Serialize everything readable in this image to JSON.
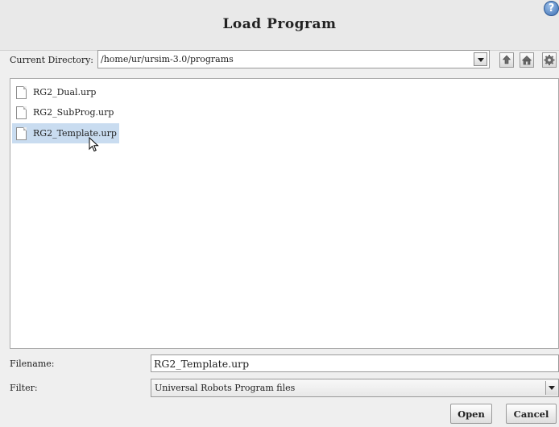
{
  "dialog": {
    "title": "Load Program",
    "help_icon": "help-circle-icon",
    "help_glyph": "?"
  },
  "directory": {
    "label": "Current Directory:",
    "value": "/home/ur/ursim-3.0/programs",
    "tools": [
      "up-folder-icon",
      "home-icon",
      "settings-gear-icon"
    ]
  },
  "files": [
    {
      "name": "RG2_Dual.urp",
      "selected": false
    },
    {
      "name": "RG2_SubProg.urp",
      "selected": false
    },
    {
      "name": "RG2_Template.urp",
      "selected": true
    }
  ],
  "filename": {
    "label": "Filename:",
    "value": "RG2_Template.urp"
  },
  "filter": {
    "label": "Filter:",
    "value": "Universal Robots Program files"
  },
  "buttons": {
    "open": "Open",
    "cancel": "Cancel"
  },
  "colors": {
    "selection": "#c9dcf0",
    "help_accent": "#3d6fb3"
  }
}
